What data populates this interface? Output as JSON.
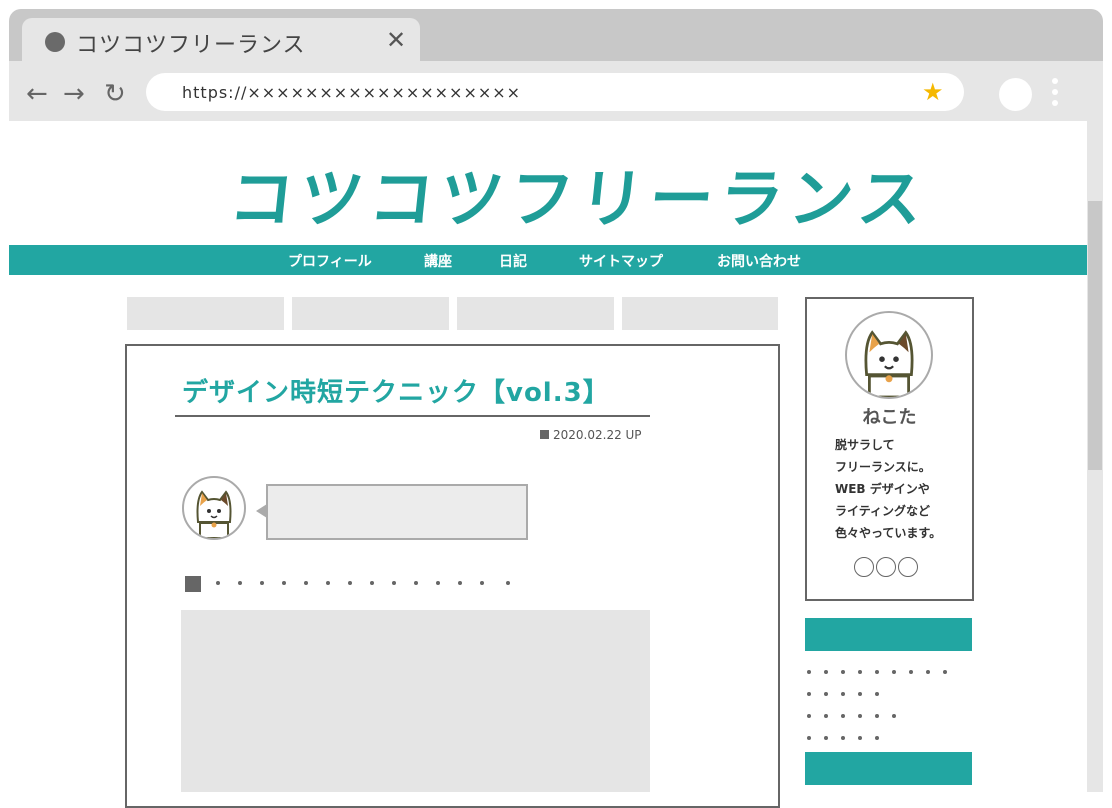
{
  "browser": {
    "tab_title": "コツコツフリーランス",
    "close_glyph": "✕",
    "url": "https://×××××××××××××××××××",
    "back_glyph": "←",
    "forward_glyph": "→",
    "reload_glyph": "↻",
    "star_glyph": "★"
  },
  "site": {
    "logo": "コツコツフリーランス",
    "nav": [
      "プロフィール",
      "講座",
      "日記",
      "サイトマップ",
      "お問い合わせ"
    ]
  },
  "article": {
    "title": "デザイン時短テクニック【vol.3】",
    "date": "2020.02.22 UP"
  },
  "sidebar": {
    "name": "ねこた",
    "bio": [
      "脱サラして",
      "フリーランスに。",
      "WEB デザインや",
      "ライティングなど",
      "色々やっています。"
    ]
  },
  "icons": {
    "avatar": "cat-avatar-icon",
    "social": "circle-icon"
  },
  "colors": {
    "accent": "#22a6a2",
    "star": "#f5b800"
  }
}
